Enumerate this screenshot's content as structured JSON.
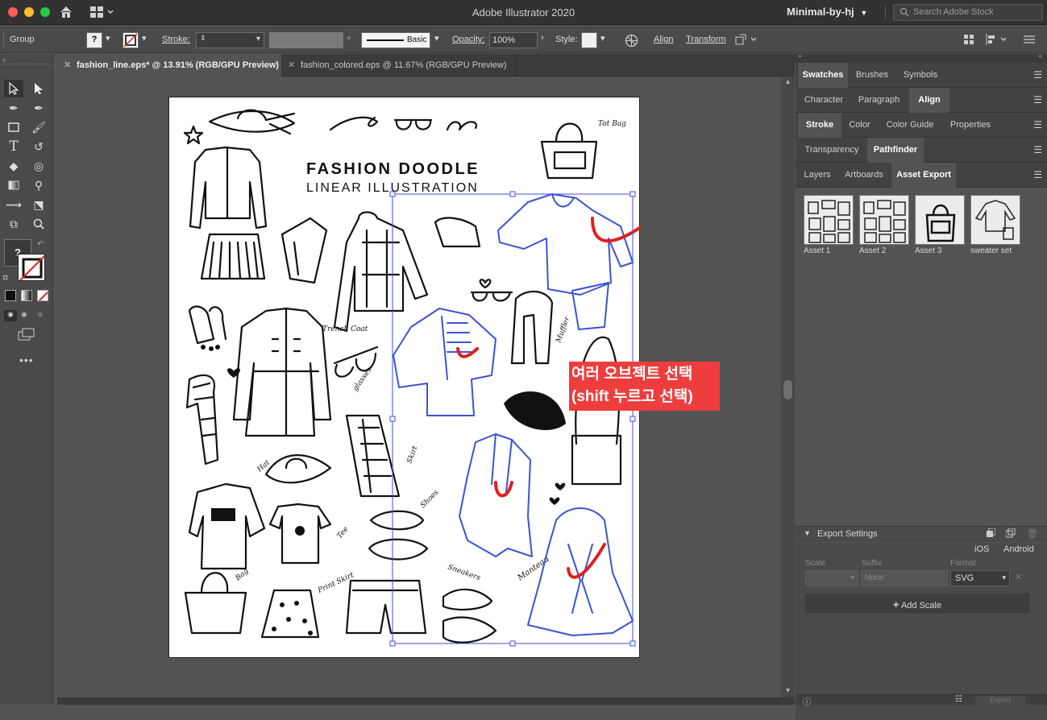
{
  "window": {
    "title": "Adobe Illustrator 2020",
    "workspace": "Minimal-by-hj",
    "search_placeholder": "Search Adobe Stock"
  },
  "control_bar": {
    "selection_type": "Group",
    "stroke_label": "Stroke:",
    "brush_value": "Basic",
    "opacity_label": "Opacity:",
    "opacity_value": "100%",
    "style_label": "Style:",
    "align_label": "Align",
    "transform_label": "Transform"
  },
  "doc_tabs": [
    {
      "label": "fashion_line.eps* @ 13.91% (RGB/GPU Preview)",
      "active": true
    },
    {
      "label": "fashion_colored.eps @ 11.67% (RGB/GPU Preview)",
      "active": false
    }
  ],
  "artboard": {
    "title": "FASHION DOODLE",
    "subtitle": "LINEAR ILLUSTRATION",
    "labels": {
      "tot_bag": "Tot Bag",
      "muffler": "Muffler",
      "trench_coat": "Trench Coat",
      "glasses": "glasses",
      "hat": "Hat",
      "skirt": "Skirt",
      "shoes": "Shoes",
      "tee": "Tee",
      "bag": "Bag",
      "print_skirt": "Print Skirt",
      "sneakers": "Sneakers",
      "manteau": "Manteau"
    }
  },
  "annotation": {
    "line1": "여러 오브젝트 선택",
    "line2": "(shift 누르고 선택)",
    "color": "#ee3d3d"
  },
  "panel": {
    "row1": [
      "Swatches",
      "Brushes",
      "Symbols"
    ],
    "row2": [
      "Character",
      "Paragraph",
      "Align"
    ],
    "row3": [
      "Stroke",
      "Color",
      "Color Guide",
      "Properties"
    ],
    "row4": [
      "Transparency",
      "Pathfinder"
    ],
    "row5": [
      "Layers",
      "Artboards",
      "Asset Export"
    ],
    "assets": [
      "Asset 1",
      "Asset 2",
      "Asset 3",
      "sweater set"
    ],
    "export_settings": "Export Settings",
    "platforms": [
      "iOS",
      "Android"
    ],
    "columns": [
      "Scale",
      "Suffix",
      "Format"
    ],
    "suffix_placeholder": "None",
    "format_value": "SVG",
    "add_scale": "Add Scale",
    "export_button": "Export"
  },
  "colors": {
    "selection_blue": "#3c52d8",
    "annotation_red": "#ee3d3d",
    "panel_bg": "#535353"
  }
}
